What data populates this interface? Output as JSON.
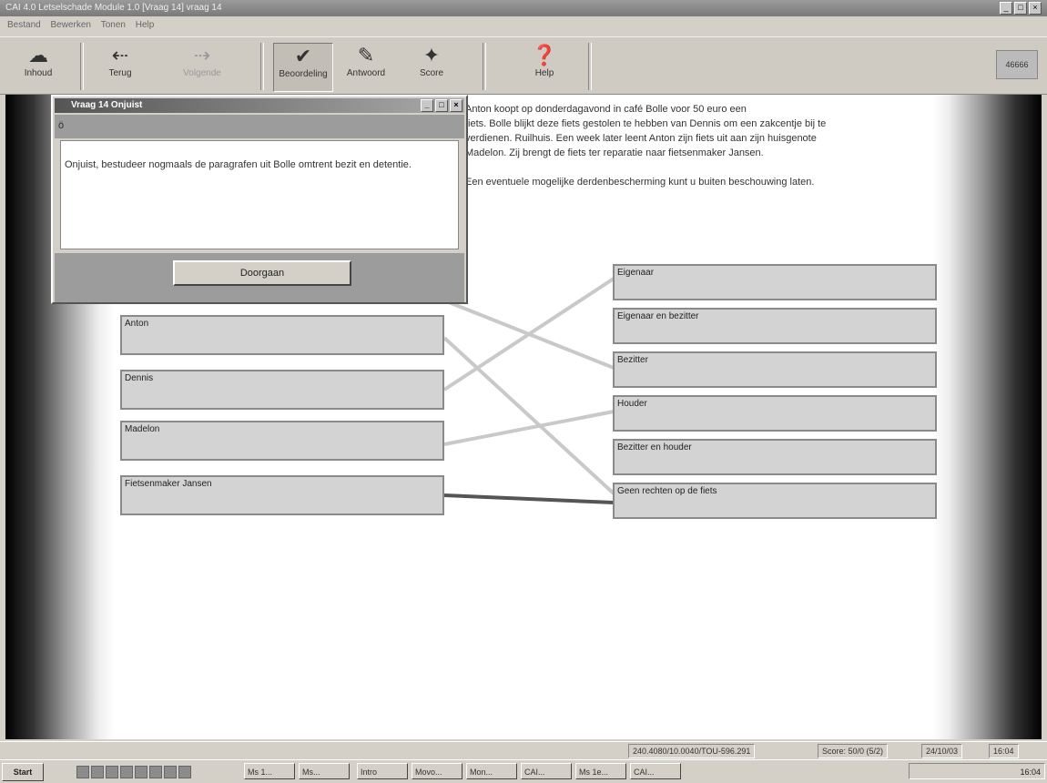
{
  "window": {
    "title": "CAI 4.0 Letselschade Module 1.0 [Vraag 14] vraag 14"
  },
  "menu": [
    "Bestand",
    "Bewerken",
    "Tonen",
    "Help"
  ],
  "toolbar": {
    "buttons": [
      {
        "label": "Inhoud",
        "icon": "book-icon"
      },
      {
        "label": "Terug",
        "icon": "arrow-left-icon"
      },
      {
        "label": "Volgende",
        "icon": "arrow-right-icon"
      },
      {
        "label": "Beoordeling",
        "icon": "check-icon"
      },
      {
        "label": "Antwoord",
        "icon": "answer-icon"
      },
      {
        "label": "Score",
        "icon": "score-icon"
      },
      {
        "label": "Help",
        "icon": "help-icon"
      }
    ],
    "right_label": "46666"
  },
  "question": {
    "lines": [
      "Anton koopt op donderdagavond in café Bolle voor 50 euro een",
      "fiets. Bolle blijkt deze fiets gestolen te hebben van Dennis om een zakcentje bij te",
      "verdienen. Ruilhuis. Een week later leent Anton zijn fiets uit aan zijn huisgenote",
      "Madelon. Zij brengt de fiets ter reparatie naar fietsenmaker Jansen.",
      "",
      "Een eventuele mogelijke derdenbescherming kunt u buiten beschouwing laten."
    ]
  },
  "left_items": [
    "Anton",
    "Dennis",
    "Madelon",
    "Fietsenmaker Jansen"
  ],
  "right_items": [
    "Eigenaar",
    "Eigenaar en bezitter",
    "Bezitter",
    "Houder",
    "Bezitter en houder",
    "Geen rechten op de fiets"
  ],
  "dialog": {
    "title": "Vraag 14 Onjuist",
    "symbol": "ö",
    "message": "Onjuist, bestudeer nogmaals de paragrafen uit Bolle omtrent bezit en detentie.",
    "button": "Doorgaan"
  },
  "status": {
    "left": "240.4080/10.0040/TOU-596.291",
    "score": "Score: 50/0 (5/2)",
    "date": "24/10/03",
    "time": "16:04"
  },
  "taskbar": {
    "start": "Start",
    "tasks": [
      "Ms 1...",
      "Ms...",
      "Intro",
      "Movo...",
      "Mon...",
      "CAI...",
      "Ms 1e...",
      "CAI..."
    ],
    "tray_time": "16:04"
  }
}
